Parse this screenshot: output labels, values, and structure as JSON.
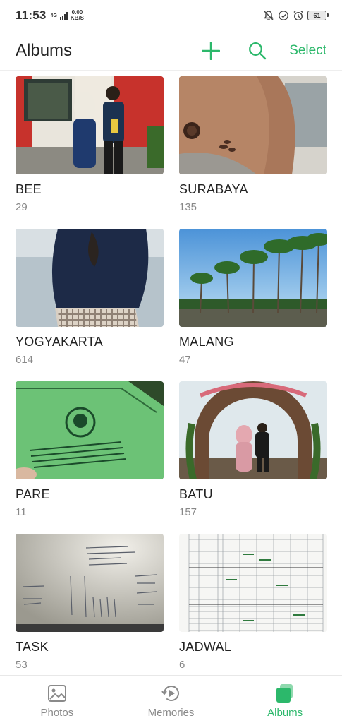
{
  "status_bar": {
    "time": "11:53",
    "network": "4G",
    "speed_value": "0.00",
    "speed_unit": "KB/S",
    "battery": "61"
  },
  "header": {
    "title": "Albums",
    "add_icon": "plus-icon",
    "search_icon": "search-icon",
    "select_label": "Select"
  },
  "albums": [
    {
      "name": "BEE",
      "count": "29"
    },
    {
      "name": "SURABAYA",
      "count": "135"
    },
    {
      "name": "YOGYAKARTA",
      "count": "614"
    },
    {
      "name": "MALANG",
      "count": "47"
    },
    {
      "name": "PARE",
      "count": "11"
    },
    {
      "name": "BATU",
      "count": "157"
    },
    {
      "name": "TASK",
      "count": "53"
    },
    {
      "name": "JADWAL",
      "count": "6"
    }
  ],
  "bottom_nav": [
    {
      "label": "Photos",
      "icon": "photos-icon",
      "active": false
    },
    {
      "label": "Memories",
      "icon": "memories-icon",
      "active": false
    },
    {
      "label": "Albums",
      "icon": "albums-icon",
      "active": true
    }
  ],
  "colors": {
    "accent": "#2cb86b",
    "text": "#222222",
    "secondary_text": "#888888"
  }
}
